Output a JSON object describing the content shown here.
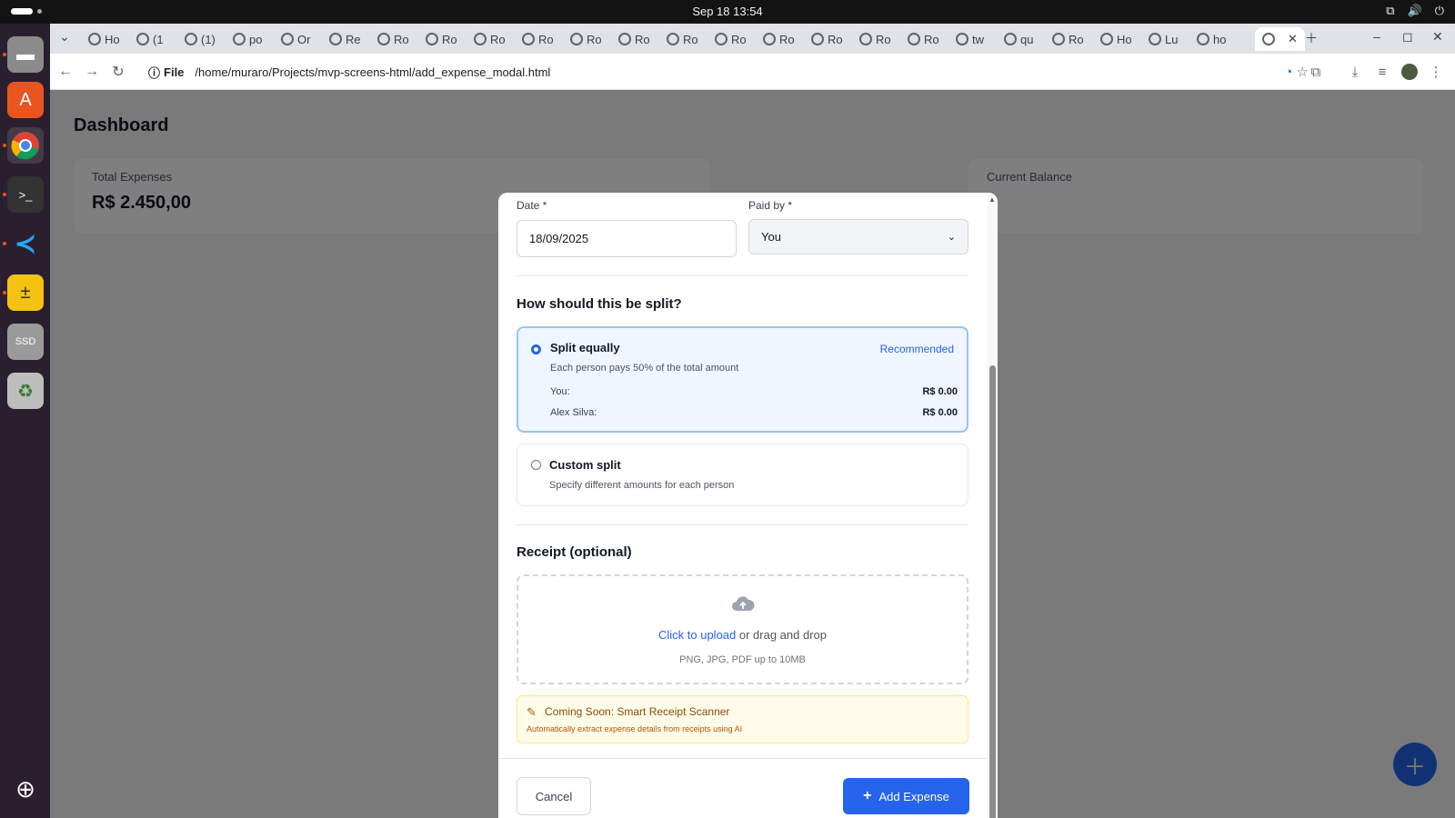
{
  "system": {
    "clock": "Sep 18  13:54"
  },
  "browser": {
    "tabs": [
      {
        "label": "Ho"
      },
      {
        "label": "(1"
      },
      {
        "label": "(1)"
      },
      {
        "label": "po"
      },
      {
        "label": "Or"
      },
      {
        "label": "Re"
      },
      {
        "label": "Ro"
      },
      {
        "label": "Ro"
      },
      {
        "label": "Ro"
      },
      {
        "label": "Ro"
      },
      {
        "label": "Ro"
      },
      {
        "label": "Ro"
      },
      {
        "label": "Ro"
      },
      {
        "label": "Ro"
      },
      {
        "label": "Ro"
      },
      {
        "label": "Ro"
      },
      {
        "label": "Ro"
      },
      {
        "label": "Ro"
      },
      {
        "label": "tw"
      },
      {
        "label": "qu"
      },
      {
        "label": "Ro"
      },
      {
        "label": "Ho"
      },
      {
        "label": "Lu"
      },
      {
        "label": "ho"
      }
    ],
    "address_scheme": "File",
    "address_url": "/home/muraro/Projects/mvp-screens-html/add_expense_modal.html"
  },
  "dashboard": {
    "title": "Dashboard",
    "stats": [
      {
        "label": "Total Expenses",
        "value": "R$ 2.450,00"
      },
      {
        "label": "Current Balance",
        "value": "$"
      }
    ]
  },
  "modal": {
    "date_label": "Date *",
    "date_value": "18/09/2025",
    "paid_by_label": "Paid by *",
    "paid_by_value": "You",
    "split_title": "How should this be split?",
    "split_equal": {
      "title": "Split equally",
      "tag": "Recommended",
      "description": "Each person pays 50% of the total amount",
      "rows": [
        {
          "name": "You:",
          "amount": "R$ 0.00"
        },
        {
          "name": "Alex Silva:",
          "amount": "R$ 0.00"
        }
      ]
    },
    "split_custom": {
      "title": "Custom split",
      "description": "Specify different amounts for each person"
    },
    "receipt_title": "Receipt (optional)",
    "upload": {
      "link": "Click to upload",
      "text": " or drag and drop",
      "hint": "PNG, JPG, PDF up to 10MB"
    },
    "coming_soon": {
      "title": "Coming Soon: Smart Receipt Scanner",
      "description": "Automatically extract expense details from receipts using AI"
    },
    "cancel_label": "Cancel",
    "add_label": "Add Expense"
  },
  "colors": {
    "primary": "#2563eb",
    "selected_bg": "#eff6ff",
    "warning_bg": "#fefce8"
  }
}
